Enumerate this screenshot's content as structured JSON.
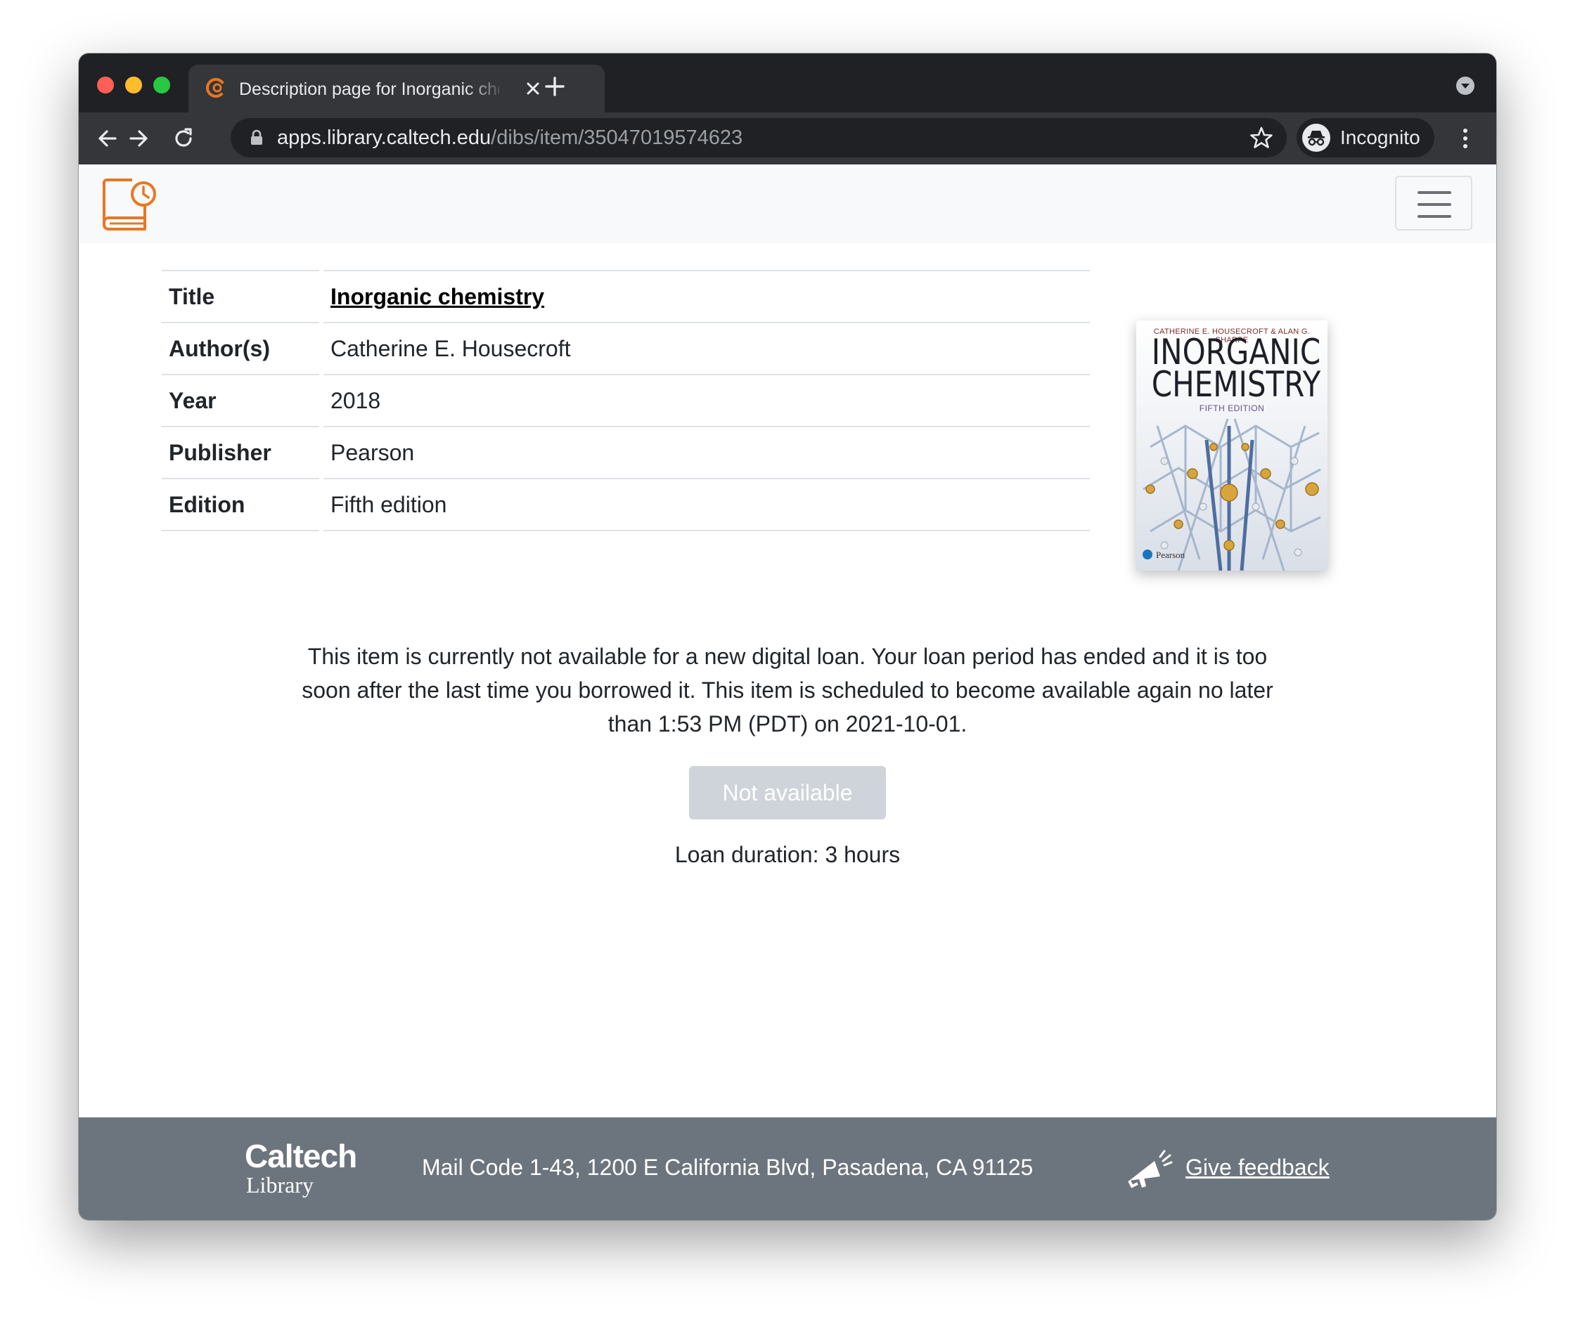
{
  "browser": {
    "tab_title": "Description page for Inorganic chemistry",
    "url_host": "apps.library.caltech.edu",
    "url_path": "/dibs/item/35047019574623",
    "profile_label": "Incognito"
  },
  "item": {
    "rows": [
      {
        "label": "Title",
        "value": "Inorganic chemistry"
      },
      {
        "label": "Author(s)",
        "value": "Catherine E. Housecroft"
      },
      {
        "label": "Year",
        "value": "2018"
      },
      {
        "label": "Publisher",
        "value": "Pearson"
      },
      {
        "label": "Edition",
        "value": "Fifth edition"
      }
    ]
  },
  "cover": {
    "authors": "CATHERINE E. HOUSECROFT & ALAN G. SHARPE",
    "title_line1": "INORGANIC",
    "title_line2": "CHEMISTRY",
    "edition": "FIFTH EDITION",
    "publisher": "Pearson"
  },
  "notice": "This item is currently not available for a new digital loan. Your loan period has ended and it is too soon after the last time you borrowed it. This item is scheduled to become available again no later than 1:53 PM (PDT) on 2021-10-01.",
  "button": {
    "label": "Not available"
  },
  "loan_duration": "Loan duration: 3 hours",
  "footer": {
    "brand_name": "Caltech",
    "brand_sub": "Library",
    "address": "Mail Code 1-43, 1200 E California Blvd, Pasadena, CA 91125",
    "feedback_label": "Give feedback"
  },
  "colors": {
    "accent_orange": "#e87722",
    "footer_gray": "#6c757d",
    "disabled_button": "#ced4da"
  },
  "icons": [
    "favicon-icon",
    "close-tab-icon",
    "new-tab-icon",
    "tab-search-icon",
    "back-arrow-icon",
    "forward-arrow-icon",
    "reload-icon",
    "lock-icon",
    "bookmark-star-icon",
    "incognito-icon",
    "menu-dots-icon",
    "book-clock-icon",
    "hamburger-icon",
    "megaphone-icon"
  ]
}
